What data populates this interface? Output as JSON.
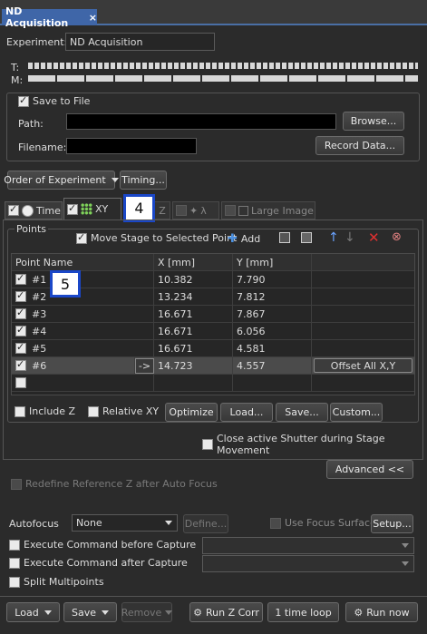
{
  "window": {
    "tab_title": "ND Acquisition",
    "close": "×"
  },
  "experiment": {
    "label": "Experiment:",
    "value": "ND Acquisition"
  },
  "progress": {
    "t_label": "T:",
    "m_label": "M:"
  },
  "save": {
    "checkbox_label": "Save to File",
    "path_label": "Path:",
    "filename_label": "Filename:",
    "browse": "Browse...",
    "record": "Record Data..."
  },
  "order": {
    "order_label": "Order of Experiment",
    "timing": "Timing..."
  },
  "tabs": [
    {
      "label": "Time"
    },
    {
      "label": "XY"
    },
    {
      "label": "Z"
    },
    {
      "label": "λ"
    },
    {
      "label": "Large Image"
    }
  ],
  "badges": {
    "b4": "4",
    "b5": "5"
  },
  "points": {
    "title": "Points",
    "move_stage": "Move Stage to Selected Point",
    "add": "Add",
    "headers": [
      "Point Name",
      "X [mm]",
      "Y [mm]"
    ],
    "rows": [
      {
        "name": "#1",
        "x": "10.382",
        "y": "7.790"
      },
      {
        "name": "#2",
        "x": "13.234",
        "y": "7.812"
      },
      {
        "name": "#3",
        "x": "16.671",
        "y": "7.867"
      },
      {
        "name": "#4",
        "x": "16.671",
        "y": "6.056"
      },
      {
        "name": "#5",
        "x": "16.671",
        "y": "4.581"
      },
      {
        "name": "#6",
        "x": "14.723",
        "y": "4.557"
      }
    ],
    "goto": "->",
    "offset": "Offset All X,Y",
    "include_z": "Include Z",
    "relative_xy": "Relative XY",
    "optimize": "Optimize",
    "load": "Load...",
    "save": "Save...",
    "custom": "Custom...",
    "close_shutter": "Close active Shutter during Stage Movement"
  },
  "advanced": {
    "button": "Advanced <<",
    "redefine": "Redefine Reference Z after Auto Focus",
    "autofocus_label": "Autofocus",
    "autofocus_value": "None",
    "define": "Define...",
    "use_focus": "Use Focus Surface",
    "setup": "Setup...",
    "exec_before": "Execute Command before Capture",
    "exec_after": "Execute Command after Capture",
    "split": "Split Multipoints"
  },
  "footer": {
    "load": "Load",
    "save": "Save",
    "remove": "Remove",
    "run_z": "Run Z Corr",
    "loop": "1 time loop",
    "run_now": "Run now"
  }
}
